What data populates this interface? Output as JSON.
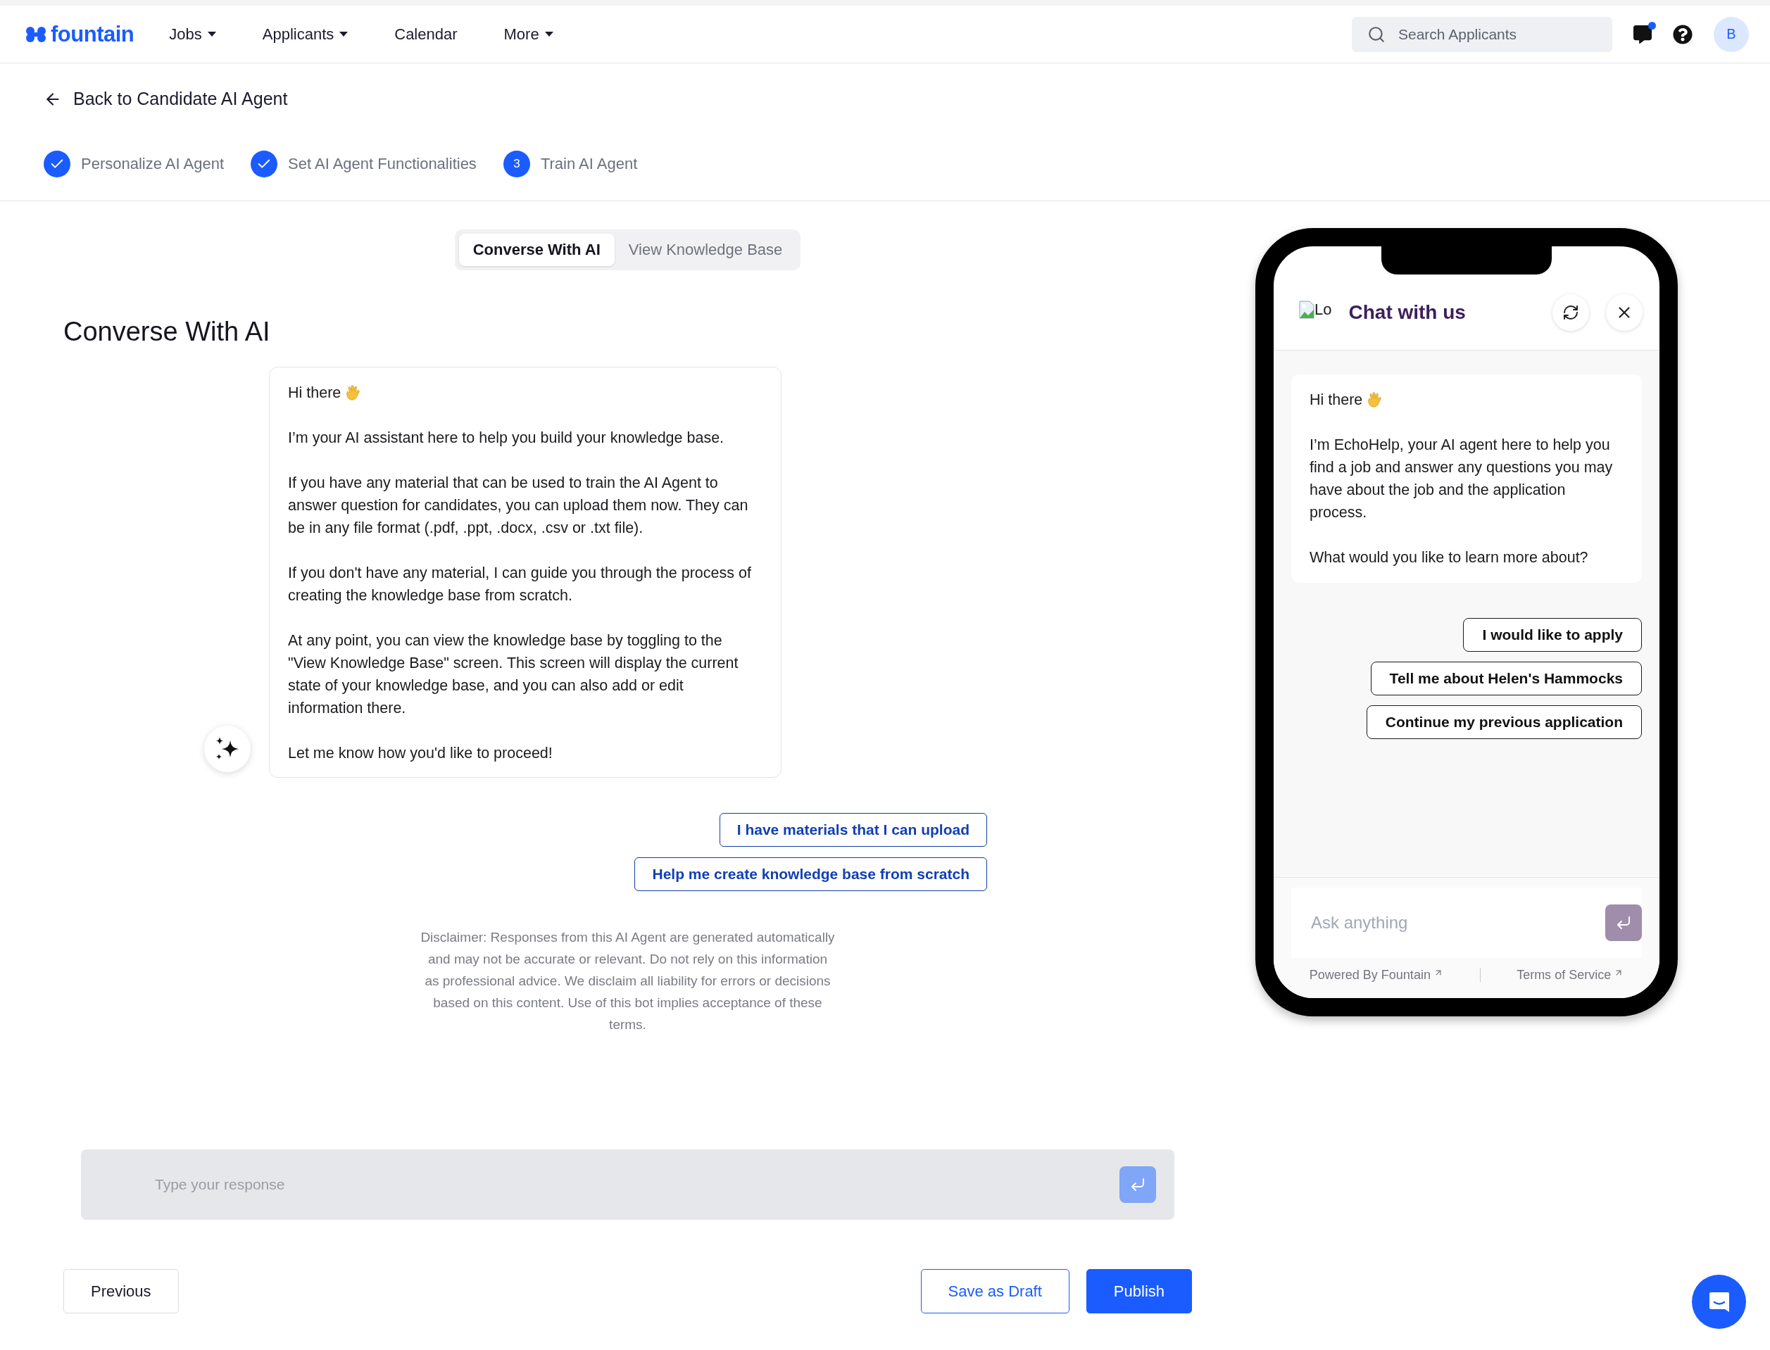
{
  "nav": {
    "logo": "fountain",
    "items": [
      {
        "label": "Jobs",
        "dropdown": true
      },
      {
        "label": "Applicants",
        "dropdown": true
      },
      {
        "label": "Calendar",
        "dropdown": false
      },
      {
        "label": "More",
        "dropdown": true
      }
    ],
    "search": {
      "placeholder": "Search Applicants"
    },
    "messages_unread": true,
    "avatar": "B"
  },
  "back_link": "Back to Candidate AI Agent",
  "steps": [
    {
      "label": "Personalize AI Agent",
      "completed": true
    },
    {
      "label": "Set AI Agent Functionalities",
      "completed": true
    },
    {
      "label": "Train AI Agent",
      "completed": false,
      "number": "3"
    }
  ],
  "mode_tabs": [
    {
      "label": "Converse With AI",
      "selected": true
    },
    {
      "label": "View Knowledge Base",
      "selected": false
    }
  ],
  "heading": "Converse With AI",
  "message": {
    "greeting": "Hi there",
    "paragraphs": [
      "I’m your AI assistant here to help you build your knowledge base.",
      "If you have any material that can be used to train the AI Agent to answer question for candidates, you can upload them now. They can be in any file format (.pdf, .ppt, .docx, .csv or .txt file).",
      "If you don't have any material, I can guide you through the process of creating the knowledge base from scratch.",
      "At any point, you can view the knowledge base by toggling to the \"View Knowledge Base\" screen. This screen will display the current state of your knowledge base, and you can also add or edit information there.",
      "Let me know how you'd like to proceed!"
    ]
  },
  "quick_replies": [
    "I have materials that I can upload",
    "Help me create knowledge base from scratch"
  ],
  "disclaimer": "Disclaimer: Responses from this AI Agent are generated automatically and may not be accurate or relevant. Do not rely on this information as professional advice. We disclaim all liability for errors or decisions based on this content. Use of this bot implies acceptance of these terms.",
  "response_input": {
    "placeholder": "Type your response"
  },
  "footer": {
    "previous": "Previous",
    "save_draft": "Save as Draft",
    "publish": "Publish"
  },
  "preview": {
    "logo_alt": "Lo",
    "title": "Chat with us",
    "message": {
      "greeting": "Hi there",
      "paragraphs": [
        "I’m EchoHelp, your AI agent here to help you find a job and answer any questions you may have about the job and the application process.",
        "What would you like to learn more about?"
      ]
    },
    "options": [
      "I would like to apply",
      "Tell me about Helen's Hammocks",
      "Continue my previous application"
    ],
    "input": {
      "placeholder": "Ask anything"
    },
    "links": [
      "Powered By Fountain",
      "Terms of Service"
    ]
  }
}
